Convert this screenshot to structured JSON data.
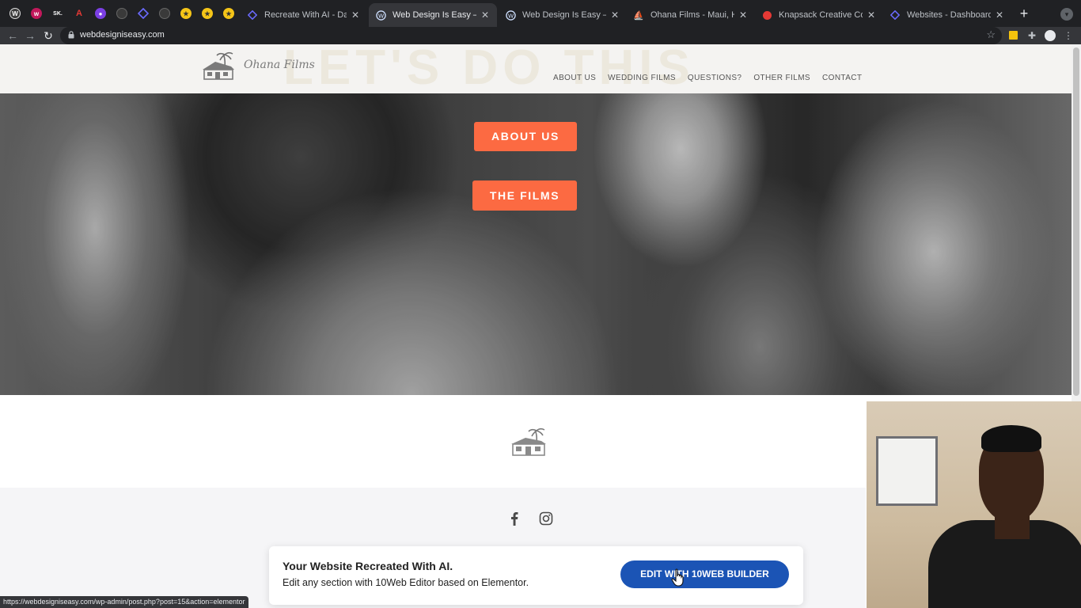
{
  "browser": {
    "tabs": [
      {
        "title": "Recreate With AI - Dashboard",
        "icon": "tenweb-diamond-icon",
        "active": false
      },
      {
        "title": "Web Design Is Easy – Just an",
        "icon": "wordpress-icon",
        "active": true
      },
      {
        "title": "Web Design Is Easy – Just an",
        "icon": "wordpress-icon",
        "active": false
      },
      {
        "title": "Ohana Films - Maui, Hawaii W",
        "icon": "ohana-films-favicon",
        "active": false
      },
      {
        "title": "Knapsack Creative Co. | Squa",
        "icon": "knapsack-favicon",
        "active": false
      },
      {
        "title": "Websites - Dashboard",
        "icon": "tenweb-diamond-icon",
        "active": false
      }
    ],
    "url": "webdesigniseasy.com",
    "status_url": "https://webdesigniseasy.com/wp-admin/post.php?post=15&action=elementor",
    "pinned_labels": {
      "sk": "SK."
    }
  },
  "site": {
    "brand": "Ohana Films",
    "ghost_text": "LET'S DO THIS",
    "nav": [
      "ABOUT US",
      "WEDDING FILMS",
      "QUESTIONS?",
      "OTHER FILMS",
      "CONTACT"
    ],
    "hero_buttons": {
      "about": "ABOUT US",
      "films": "THE FILMS"
    },
    "accent_color": "#fc6a42"
  },
  "promo": {
    "title": "Your Website Recreated With AI.",
    "subtitle": "Edit any section with 10Web Editor based on Elementor.",
    "button": "EDIT WITH 10WEB BUILDER",
    "button_color": "#1b54b5"
  }
}
